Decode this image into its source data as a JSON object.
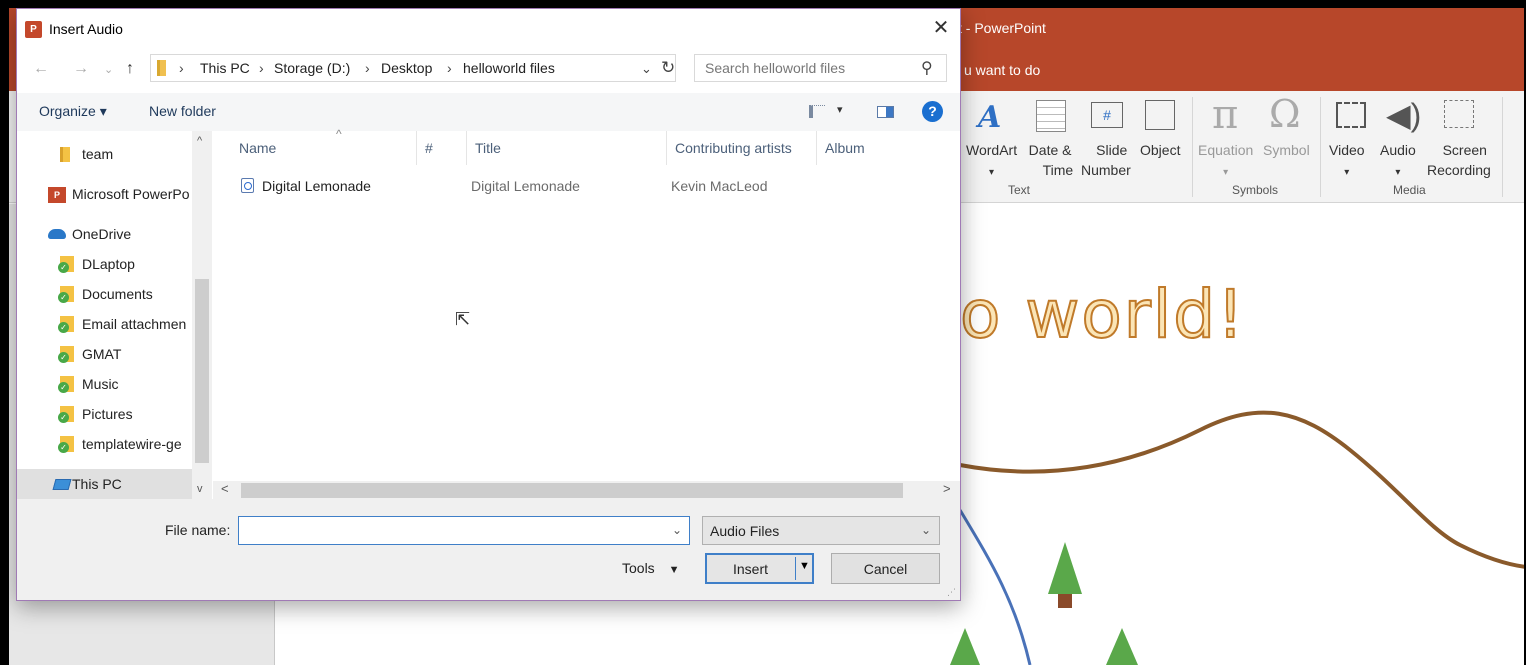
{
  "powerpoint": {
    "title": "t  -  PowerPoint",
    "tell_me": "u want to do",
    "ribbon": {
      "wordart": "WordArt",
      "date_time": "Date &",
      "date_time_2": "Time",
      "slide_number": "Slide",
      "slide_number_2": "Number",
      "object": "Object",
      "equation": "Equation",
      "symbol": "Symbol",
      "video": "Video",
      "audio": "Audio",
      "screen_recording": "Screen",
      "screen_recording_2": "Recording",
      "group_text": "Text",
      "group_symbols": "Symbols",
      "group_media": "Media"
    },
    "slide_title": "o world!"
  },
  "dialog": {
    "title": "Insert Audio",
    "app_icon": "P",
    "close": "✕",
    "breadcrumb": [
      "This PC",
      "Storage (D:)",
      "Desktop",
      "helloworld files"
    ],
    "search_placeholder": "Search helloworld files",
    "toolbar": {
      "organize": "Organize ▾",
      "new_folder": "New folder",
      "help": "?"
    },
    "nav": {
      "items": [
        {
          "label": "team",
          "icon": "folder-icon"
        },
        {
          "label": "Microsoft PowerPo",
          "icon": "powerpoint-icon"
        },
        {
          "label": "OneDrive",
          "icon": "onedrive-icon"
        },
        {
          "label": "DLaptop",
          "icon": "synced-folder-icon"
        },
        {
          "label": "Documents",
          "icon": "synced-folder-icon"
        },
        {
          "label": "Email attachmen",
          "icon": "synced-folder-icon"
        },
        {
          "label": "GMAT",
          "icon": "synced-folder-icon"
        },
        {
          "label": "Music",
          "icon": "synced-folder-icon"
        },
        {
          "label": "Pictures",
          "icon": "synced-folder-icon"
        },
        {
          "label": "templatewire-ge",
          "icon": "synced-folder-icon"
        },
        {
          "label": "This PC",
          "icon": "pc-icon"
        }
      ]
    },
    "columns": [
      "Name",
      "#",
      "Title",
      "Contributing artists",
      "Album"
    ],
    "files": [
      {
        "name": "Digital Lemonade",
        "track": "",
        "title": "Digital Lemonade",
        "artists": "Kevin MacLeod",
        "album": ""
      }
    ],
    "file_name_label": "File name:",
    "file_name_value": "",
    "file_type": "Audio Files",
    "tools_label": "Tools",
    "insert_label": "Insert",
    "cancel_label": "Cancel"
  },
  "colors": {
    "ppt_accent": "#b7472a",
    "dialog_border": "#a07ab5",
    "focus_blue": "#3f7fc8"
  }
}
